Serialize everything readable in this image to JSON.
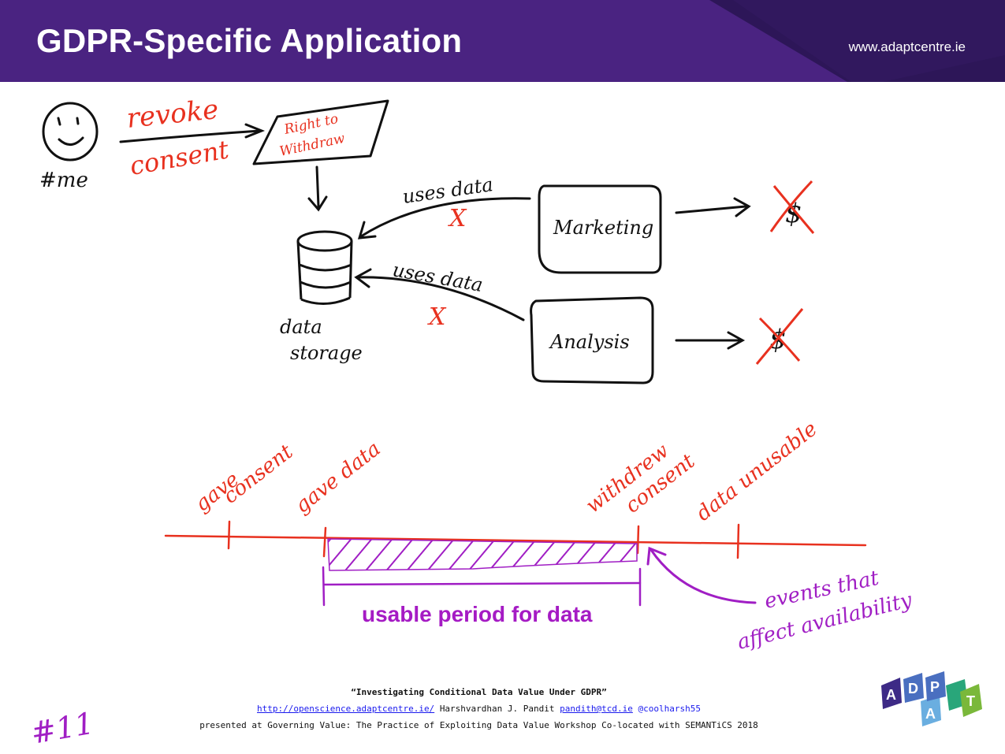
{
  "header": {
    "title": "GDPR-Specific Application",
    "site": "www.adaptcentre.ie"
  },
  "sketch": {
    "me_label": "#me",
    "revoke": "revoke",
    "consent": "consent",
    "right_to": "Right to",
    "withdraw": "Withdraw",
    "uses_data_1": "uses data",
    "uses_data_2": "uses data",
    "cross_mark": "X",
    "data": "data",
    "storage": "storage",
    "marketing": "Marketing",
    "analysis": "Analysis",
    "dollar": "$"
  },
  "timeline": {
    "gave_consent_1": "gave",
    "gave_consent_2": "consent",
    "gave_data": "gave data",
    "withdrew_1": "withdrew",
    "withdrew_2": "consent",
    "data_unusable": "data unusable",
    "usable_period": "usable period for data",
    "events_1": "events that",
    "events_2": "affect availability"
  },
  "slide_number": "#11",
  "footer": {
    "paper_title": "“Investigating Conditional Data Value Under GDPR”",
    "url": "http://openscience.adaptcentre.ie/",
    "author": "Harshvardhan J. Pandit",
    "email": "pandith@tcd.ie",
    "twitter": "@coolharsh55",
    "presented": "presented at Governing Value: The Practice of Exploiting Data Value Workshop Co-located with SEMANTiCS 2018"
  },
  "logo": {
    "letters": [
      "A",
      "D",
      "A",
      "P",
      "T"
    ],
    "colors": [
      "#3d2a86",
      "#4a6fc0",
      "#6aaee0",
      "#29a67a",
      "#7ab83a"
    ]
  },
  "colors": {
    "header_purple": "#4a2381",
    "header_dark": "#2a1552",
    "ink_red": "#e8311f",
    "ink_purple": "#a01ec4",
    "ink_black": "#111111"
  }
}
